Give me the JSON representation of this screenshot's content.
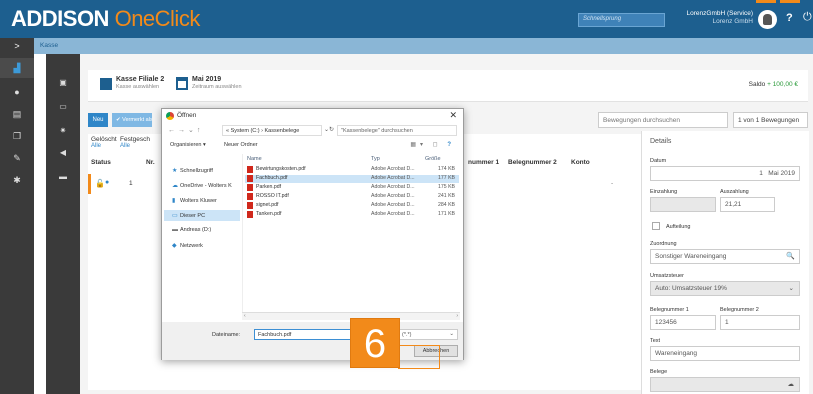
{
  "header": {
    "logo_part1": "ADDISON",
    "logo_part2": "OneClick",
    "search_placeholder": "Schnellsprung",
    "user_name": "LorenzGmbH (Service)",
    "company": "Lorenz GmbH"
  },
  "breadcrumb": {
    "arrow": ">",
    "current": "Kasse"
  },
  "kasse": {
    "title": "Kasse Filiale 2",
    "sub": "Kasse auswählen",
    "month": "Mai 2019",
    "month_sub": "Zeitraum auswählen",
    "saldo_label": "Saldo",
    "saldo_value": "+ 100,00 €"
  },
  "toolbar": {
    "new_label": "Neu",
    "verm_label": "✔ Vermerkt als",
    "search_placeholder": "Bewegungen durchsuchen",
    "pager": "1 von 1 Bewegungen"
  },
  "filters": {
    "geloscht": "Gelöscht",
    "geloscht_v": "Alle",
    "fest": "Festgesch",
    "fest_v": "Alle"
  },
  "table": {
    "headers": [
      "Status",
      "Nr.",
      "nummer 1",
      "Belegnummer 2",
      "Konto"
    ],
    "row": {
      "nr": "1",
      "konto": "-"
    }
  },
  "details": {
    "title": "Details",
    "datum_label": "Datum",
    "datum_day": "1",
    "datum_month": "Mai 2019",
    "einz_label": "Einzahlung",
    "ausz_label": "Auszahlung",
    "ausz_value": "21,21",
    "aufteilung": "Aufteilung",
    "zuord_label": "Zuordnung",
    "zuord_value": "Sonstiger Wareneingang",
    "ust_label": "Umsatzsteuer",
    "ust_value": "Auto: Umsatzsteuer 19%",
    "bn1_label": "Belegnummer 1",
    "bn1_value": "123456",
    "bn2_label": "Belegnummer 2",
    "bn2_value": "1",
    "text_label": "Text",
    "text_value": "Wareneingang",
    "belege_label": "Belege"
  },
  "dialog": {
    "title": "Öffnen",
    "path": "« System (C:) › Kassenbelege",
    "search_placeholder": "\"Kassenbelege\" durchsuchen",
    "organisieren": "Organisieren ▾",
    "neuer_ordner": "Neuer Ordner",
    "nav": [
      {
        "label": "Schnellzugriff",
        "icon": "★"
      },
      {
        "label": "OneDrive - Wolters K",
        "icon": "☁"
      },
      {
        "label": "Wolters Kluwer",
        "icon": "▮"
      },
      {
        "label": "Dieser PC",
        "icon": "▭"
      },
      {
        "label": "Andreas (D:)",
        "icon": "▬"
      },
      {
        "label": "Netzwerk",
        "icon": "◆"
      }
    ],
    "col_name": "Name",
    "col_type": "Typ",
    "col_size": "Größe",
    "files": [
      {
        "name": "Bewirtungskosten.pdf",
        "type": "Adobe Acrobat D...",
        "size": "174 KB"
      },
      {
        "name": "Fachbuch.pdf",
        "type": "Adobe Acrobat D...",
        "size": "177 KB"
      },
      {
        "name": "Parken.pdf",
        "type": "Adobe Acrobat D...",
        "size": "175 KB"
      },
      {
        "name": "ROSSO IT.pdf",
        "type": "Adobe Acrobat D...",
        "size": "241 KB"
      },
      {
        "name": "signet.pdf",
        "type": "Adobe Acrobat D...",
        "size": "284 KB"
      },
      {
        "name": "Tanken.pdf",
        "type": "Adobe Acrobat D...",
        "size": "171 KB"
      }
    ],
    "filename_label": "Dateiname:",
    "filename_value": "Fachbuch.pdf",
    "filetype_value": "(*.*)",
    "cancel_label": "Abbrechen"
  },
  "step_badge": "6",
  "colors": {
    "brand_blue": "#1d5f8f",
    "accent_orange": "#f28a1a"
  }
}
